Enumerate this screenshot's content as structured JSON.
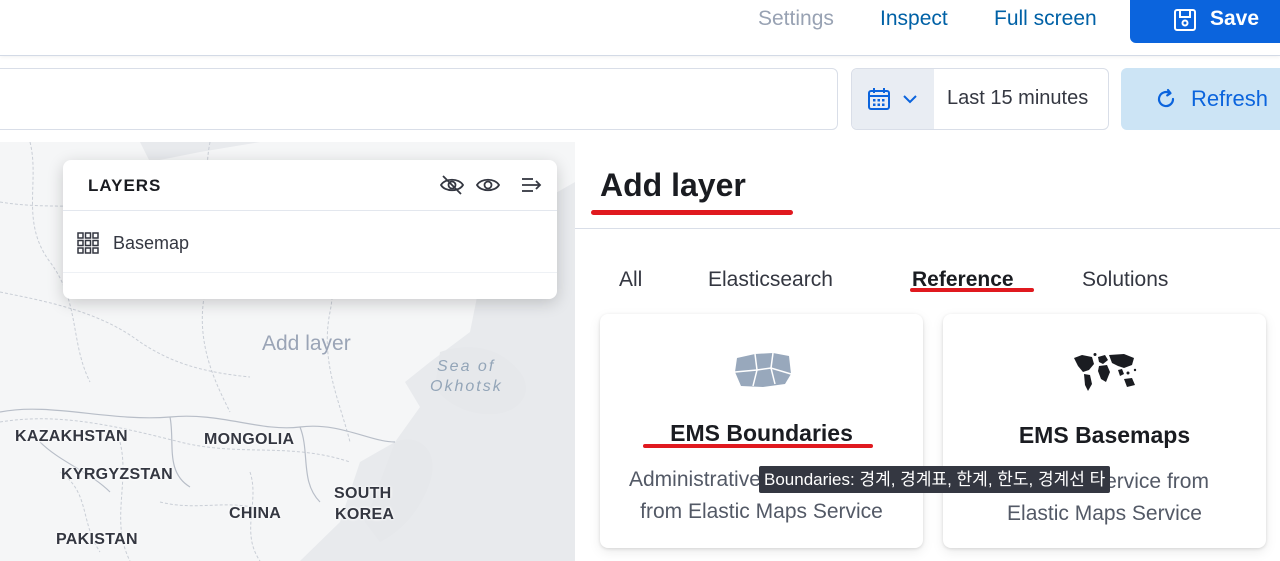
{
  "header": {
    "settings_label": "Settings",
    "inspect_label": "Inspect",
    "fullscreen_label": "Full screen",
    "save_label": "Save"
  },
  "querybar": {
    "time_range": "Last 15 minutes",
    "refresh_label": "Refresh"
  },
  "map": {
    "layers_title": "LAYERS",
    "layers": [
      {
        "label": "Basemap"
      }
    ],
    "ghost_text": "Add layer",
    "countries": {
      "kazakhstan": "KAZAKHSTAN",
      "mongolia": "MONGOLIA",
      "kyrgyzstan": "KYRGYZSTAN",
      "south": "SOUTH",
      "korea": "KOREA",
      "china": "CHINA",
      "pakistan": "PAKISTAN"
    },
    "sea_line1": "Sea of",
    "sea_line2": "Okhotsk"
  },
  "flyout": {
    "title": "Add layer",
    "tabs": [
      {
        "label": "All"
      },
      {
        "label": "Elasticsearch"
      },
      {
        "label": "Reference",
        "active": true
      },
      {
        "label": "Solutions"
      }
    ],
    "cards": [
      {
        "title": "EMS Boundaries",
        "desc_line1": "Administrative",
        "desc_line2": "from Elastic Maps Service"
      },
      {
        "title": "EMS Basemaps",
        "desc_line1": "Basemap service from",
        "desc_line2": "Elastic Maps Service"
      }
    ],
    "tooltip": "Boundaries: 경계, 경계표, 한계, 한도, 경계선 타"
  },
  "colors": {
    "primary": "#0b64dd",
    "link": "#0061a6",
    "annotation_red": "#e0191f"
  }
}
